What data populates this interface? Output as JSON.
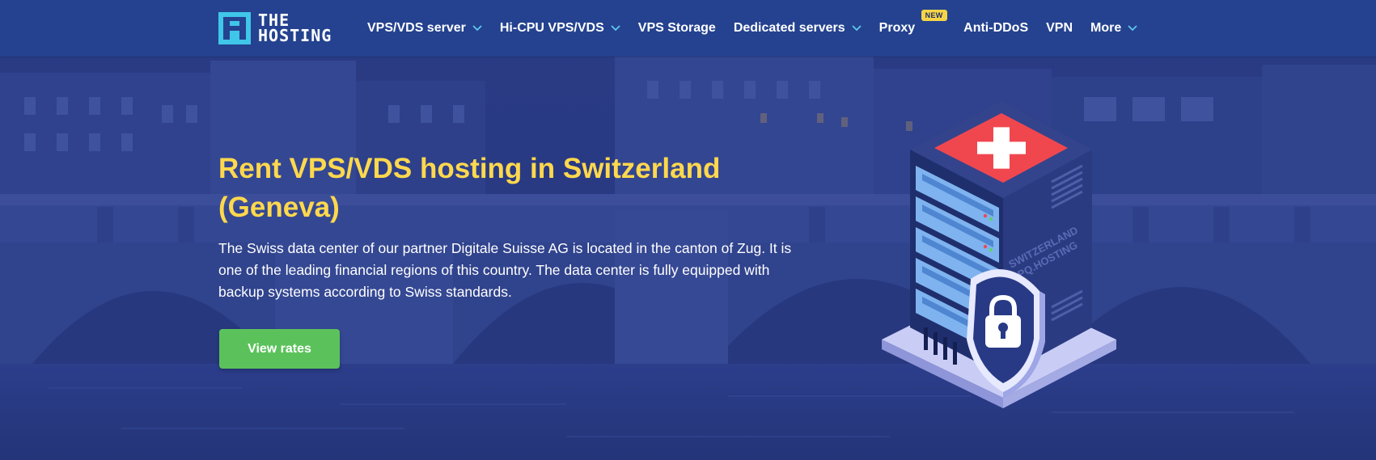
{
  "header": {
    "logo": {
      "line1": "THE",
      "line2": "HOSTING"
    },
    "nav": [
      {
        "label": "VPS/VDS server",
        "has_dropdown": true
      },
      {
        "label": "Hi-CPU VPS/VDS",
        "has_dropdown": true
      },
      {
        "label": "VPS Storage",
        "has_dropdown": false
      },
      {
        "label": "Dedicated servers",
        "has_dropdown": true
      },
      {
        "label": "Proxy",
        "has_dropdown": false,
        "badge": "NEW"
      },
      {
        "label": "Anti-DDoS",
        "has_dropdown": false
      },
      {
        "label": "VPN",
        "has_dropdown": false
      },
      {
        "label": "More",
        "has_dropdown": true
      }
    ]
  },
  "hero": {
    "title_line1": "Rent VPS/VDS hosting in Switzerland",
    "title_line2": "(Geneva)",
    "description": "The Swiss data center of our partner Digitale Suisse AG is located in the canton of Zug. It is one of the leading financial regions of this country. The data center is fully equipped with backup systems according to Swiss standards.",
    "cta_label": "View rates"
  },
  "illustration": {
    "side_text_line1": "SWITZERLAND",
    "side_text_line2": "PQ.HOSTING",
    "icons": [
      "swiss-cross-icon",
      "padlock-icon",
      "shield-icon"
    ]
  },
  "colors": {
    "header_bg": "#24428f",
    "hero_overlay": "#2a3d8a",
    "title_yellow": "#ffd84d",
    "cta_green": "#5bc25b",
    "logo_cyan": "#3fc6e8",
    "chevron_cyan": "#5fc8ec",
    "badge_yellow": "#f5d547",
    "swiss_red": "#f0474f"
  }
}
